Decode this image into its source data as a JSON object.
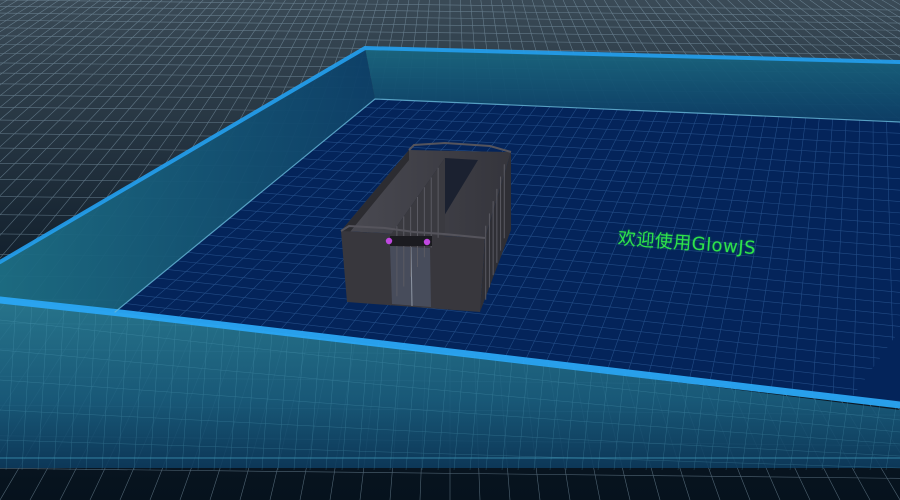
{
  "scene": {
    "welcome_text": "欢迎使用GlowJS",
    "objects": [
      "ground-grid",
      "platform",
      "server-room-model"
    ],
    "colors": {
      "background": "#05101c",
      "grid_line": "#8aa6b8",
      "platform_fill": "#04245a",
      "border_glow": "#23a0f0",
      "frame_band": "#1c6f8c",
      "cabinet": "#3c3b41",
      "indicator_lights": "#c048e0",
      "welcome_text": "#2ee34a"
    }
  }
}
